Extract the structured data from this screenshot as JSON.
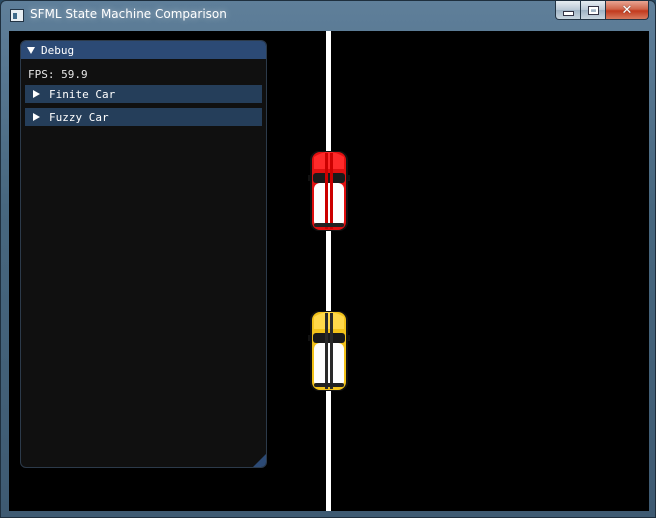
{
  "window": {
    "title": "SFML State Machine Comparison",
    "controls": {
      "minimize_icon": "minimize-icon",
      "maximize_icon": "maximize-icon",
      "close_glyph": "✕"
    }
  },
  "scene": {
    "background_color": "#000000",
    "lane_line_color": "#ffffff",
    "cars": [
      {
        "name": "red-car",
        "color": "#e01010"
      },
      {
        "name": "yellow-car",
        "color": "#f2c21a"
      }
    ]
  },
  "debug_panel": {
    "title": "Debug",
    "fps_label": "FPS:",
    "fps_value": "59.9",
    "nodes": [
      {
        "label": "Finite Car"
      },
      {
        "label": "Fuzzy Car"
      }
    ],
    "header_color": "#2c4a75",
    "node_color": "#253e5a"
  }
}
